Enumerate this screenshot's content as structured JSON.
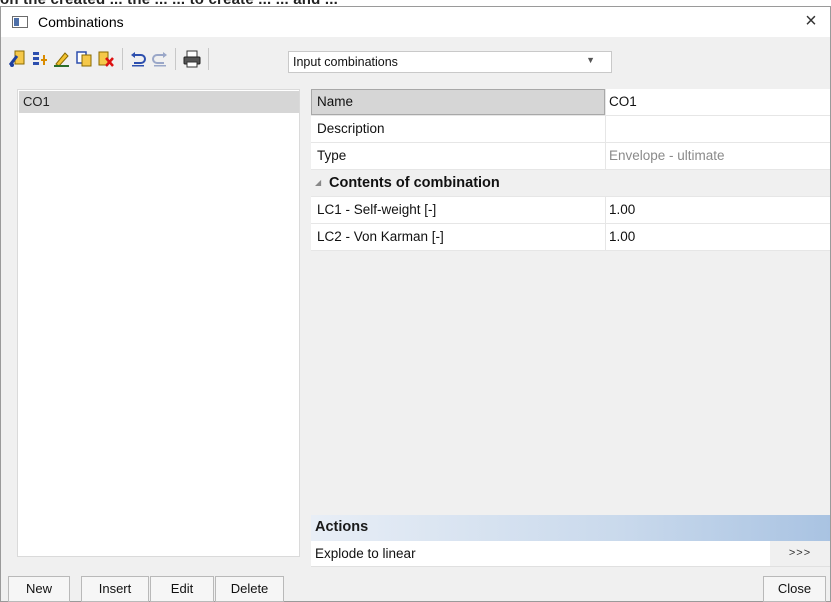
{
  "window": {
    "title": "Combinations",
    "close_glyph": "×"
  },
  "toolbar": {
    "icons": [
      "new-icon",
      "insert-icon",
      "edit-icon",
      "copy-icon",
      "delete-icon",
      "undo-icon",
      "redo-icon",
      "print-icon"
    ],
    "combo_value": "Input combinations"
  },
  "list": {
    "items": [
      {
        "label": "CO1",
        "selected": true
      }
    ]
  },
  "properties": {
    "rows": [
      {
        "name": "Name",
        "value": "CO1"
      },
      {
        "name": "Description",
        "value": ""
      },
      {
        "name": "Type",
        "value": "Envelope - ultimate"
      }
    ],
    "group": {
      "label": "Contents of combination",
      "rows": [
        {
          "name": "LC1 - Self-weight [-]",
          "value": "1.00"
        },
        {
          "name": "LC2 - Von Karman [-]",
          "value": "1.00"
        }
      ]
    }
  },
  "actions": {
    "header": "Actions",
    "items": [
      {
        "label": "Explode to linear",
        "button": ">>>"
      }
    ]
  },
  "buttons": {
    "new": "New",
    "insert": "Insert",
    "edit": "Edit",
    "delete": "Delete",
    "close": "Close"
  },
  "background_text": "on the created ... the ... ... to create ... ... and ..."
}
